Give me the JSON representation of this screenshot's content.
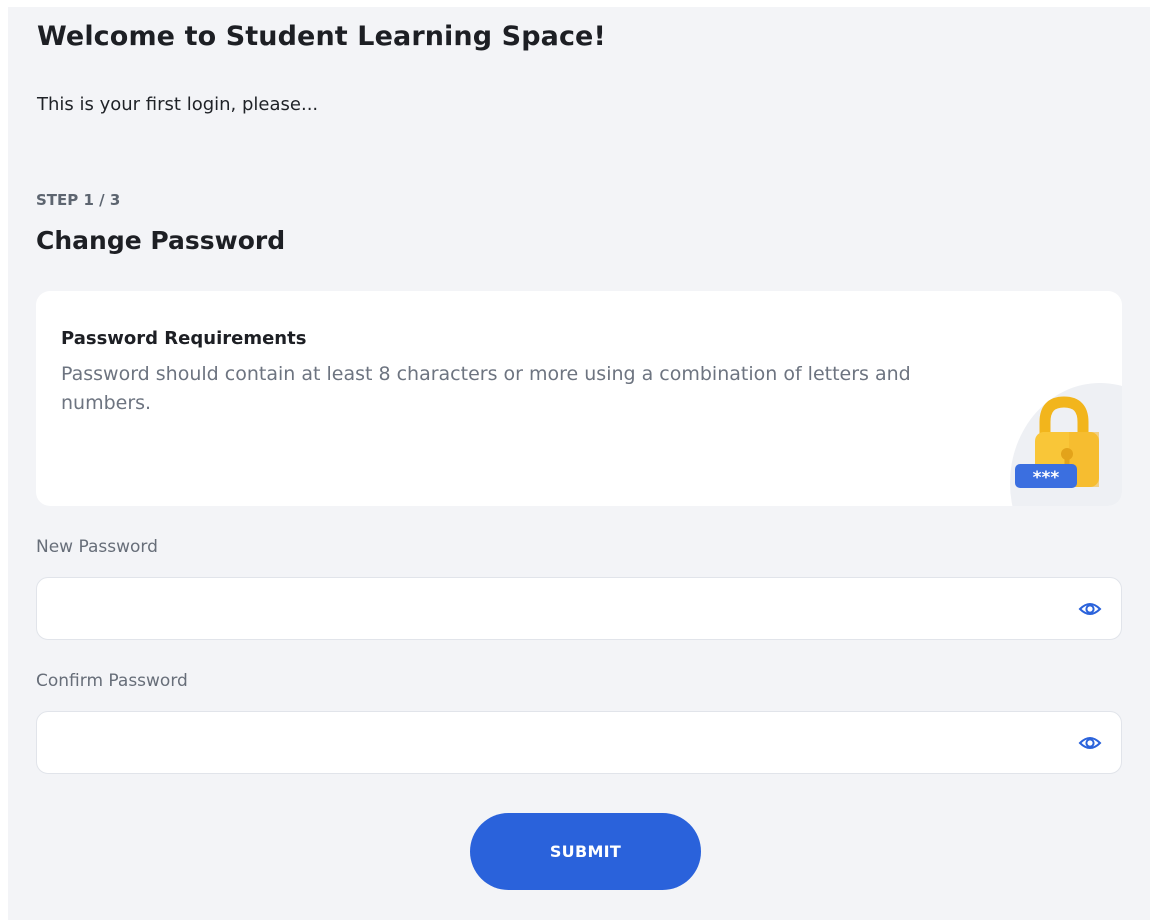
{
  "header": {
    "title": "Welcome to Student Learning Space!",
    "intro": "This is your first login, please..."
  },
  "step": {
    "indicator": "STEP 1 / 3",
    "title": "Change Password"
  },
  "requirements": {
    "title": "Password Requirements",
    "description": "Password should contain at least 8 characters or more using a combination of letters and numbers.",
    "icon": "lock-icon",
    "badge_text": "***"
  },
  "form": {
    "new_password": {
      "label": "New Password",
      "value": "",
      "toggle_icon": "eye-icon"
    },
    "confirm_password": {
      "label": "Confirm Password",
      "value": "",
      "toggle_icon": "eye-icon"
    },
    "submit_label": "SUBMIT"
  },
  "colors": {
    "background": "#f3f4f7",
    "card": "#ffffff",
    "primary": "#2a62db",
    "lock_yellow": "#f9c638",
    "badge_blue": "#3b6fe0",
    "muted_text": "#6d7480"
  }
}
